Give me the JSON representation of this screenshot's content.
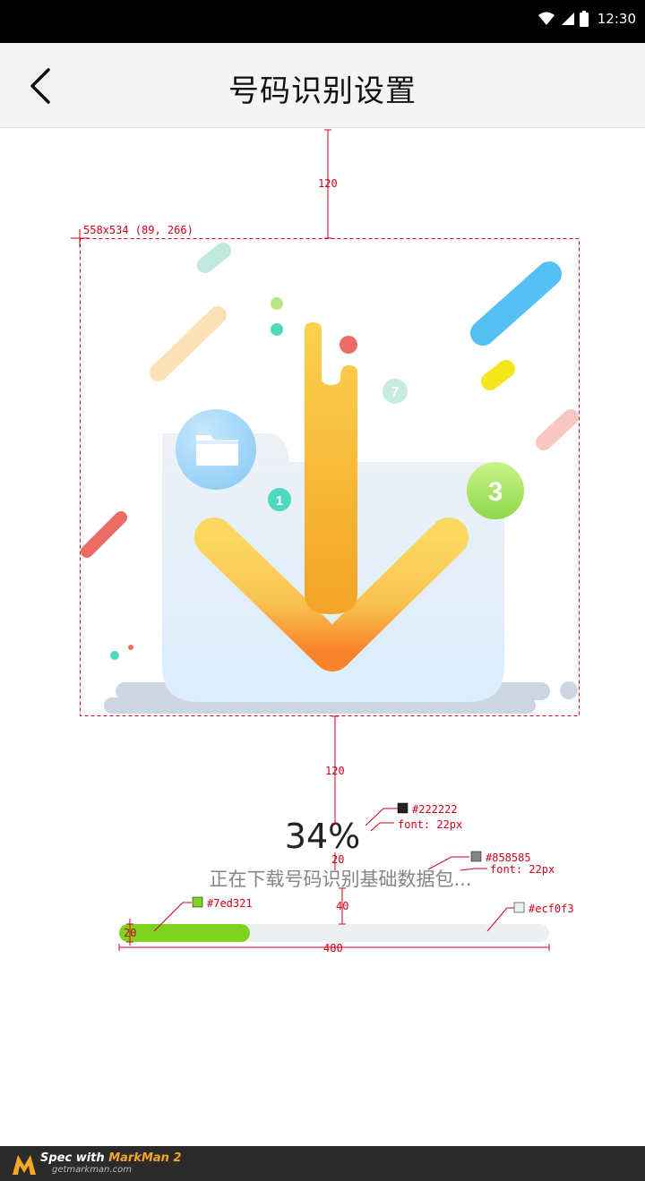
{
  "status_bar": {
    "time": "12:30",
    "icons": [
      "wifi-icon",
      "signal-icon",
      "battery-icon"
    ]
  },
  "header": {
    "title": "号码识别设置",
    "back_icon": "chevron-left-icon"
  },
  "illustration": {
    "badges": [
      "1",
      "3",
      "7"
    ],
    "folder_icon": "folder-icon",
    "arrow_icon": "download-arrow-icon"
  },
  "progress": {
    "percent_label": "34%",
    "status_text": "正在下载号码识别基础数据包...",
    "fraction": 0.305,
    "fill_color": "#7ed321",
    "track_color": "#ecf0f3"
  },
  "annotations": {
    "spacing_top": "120",
    "box_label": "558x534 (89, 266)",
    "spacing_bottom": "120",
    "gap_percent_text": "20",
    "gap_text_bar": "40",
    "bar_height": "20",
    "bar_width": "480",
    "percent_color": "#222222",
    "percent_font": "font: 22px",
    "text_color": "#858585",
    "text_font": "font: 22px",
    "fill_color_label": "#7ed321",
    "track_color_label": "#ecf0f3"
  },
  "footer": {
    "title_prefix": "Spec with ",
    "brand": "MarkMan 2",
    "url": "getmarkman.com"
  }
}
